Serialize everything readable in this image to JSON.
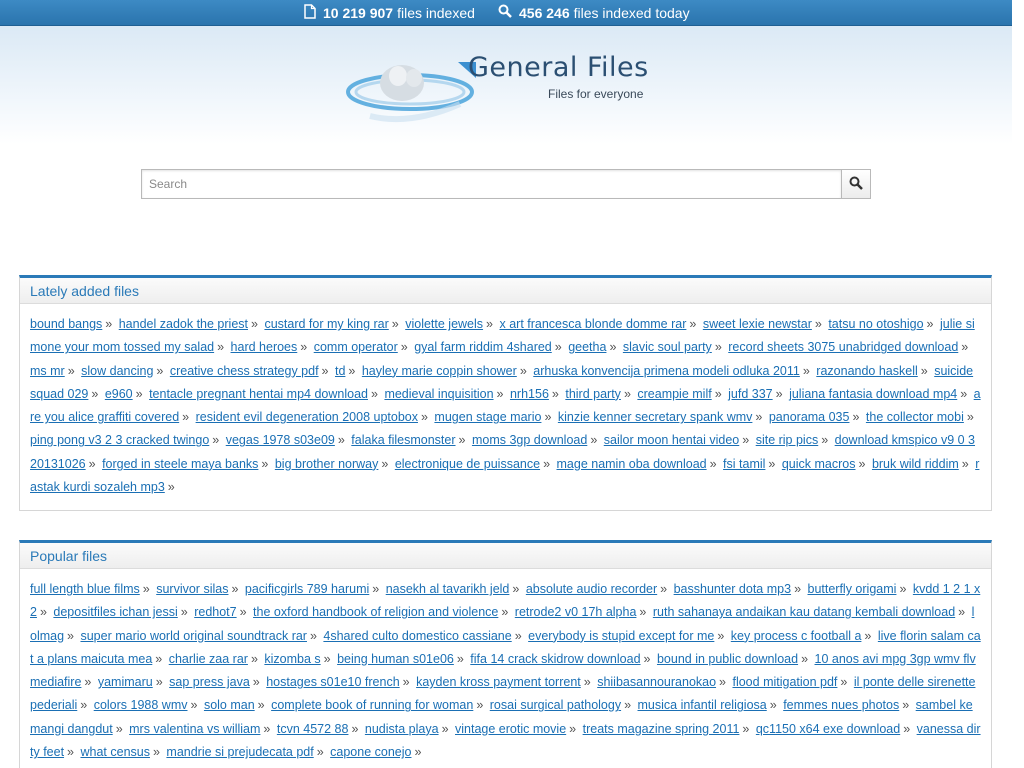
{
  "topbar": {
    "files_indexed_count": "10 219 907",
    "files_indexed_label": "files indexed",
    "files_today_count": "456 246",
    "files_today_label": "files indexed today",
    "icons": [
      "document-icon",
      "search-icon"
    ]
  },
  "logo": {
    "title": "General Files",
    "subtitle": "Files for everyone"
  },
  "search": {
    "placeholder": "Search",
    "value": ""
  },
  "lately_added": {
    "heading": "Lately added files",
    "items": [
      "bound bangs",
      "handel zadok the priest",
      "custard for my king rar",
      "violette jewels",
      "x art francesca blonde domme rar",
      "sweet lexie newstar",
      "tatsu no otoshigo",
      "julie simone your mom tossed my salad",
      "hard heroes",
      "comm operator",
      "gyal farm riddim 4shared",
      "geetha",
      "slavic soul party",
      "record sheets 3075 unabridged download",
      "ms mr",
      "slow dancing",
      "creative chess strategy pdf",
      "td",
      "hayley marie coppin shower",
      "arhuska konvencija primena modeli odluka 2011",
      "razonando haskell",
      "suicide squad 029",
      "e960",
      "tentacle pregnant hentai mp4 download",
      "medieval inquisition",
      "nrh156",
      "third party",
      "creampie milf",
      "jufd 337",
      "juliana fantasia download mp4",
      "are you alice graffiti covered",
      "resident evil degeneration 2008 uptobox",
      "mugen stage mario",
      "kinzie kenner secretary spank wmv",
      "panorama 035",
      "the collector mobi",
      "ping pong v3 2 3 cracked twingo",
      "vegas 1978 s03e09",
      "falaka filesmonster",
      "moms 3gp download",
      "sailor moon hentai video",
      "site rip pics",
      "download kmspico v9 0 3 20131026",
      "forged in steele maya banks",
      "big brother norway",
      "electronique de puissance",
      "mage namin oba download",
      "fsi tamil",
      "quick macros",
      "bruk wild riddim",
      "rastak kurdi sozaleh mp3"
    ]
  },
  "popular": {
    "heading": "Popular files",
    "items": [
      "full length blue films",
      "survivor silas",
      "pacificgirls 789 harumi",
      "nasekh al tavarikh jeld",
      "absolute audio recorder",
      "basshunter dota mp3",
      "butterfly origami",
      "kvdd 1 2 1 x2",
      "depositfiles ichan jessi",
      "redhot7",
      "the oxford handbook of religion and violence",
      "retrode2 v0 17h alpha",
      "ruth sahanaya andaikan kau datang kembali download",
      "lolmag",
      "super mario world original soundtrack rar",
      "4shared culto domestico cassiane",
      "everybody is stupid except for me",
      "key process c football a",
      "live florin salam cat a plans maicuta mea",
      "charlie zaa rar",
      "kizomba s",
      "being human s01e06",
      "fifa 14 crack skidrow download",
      "bound in public download",
      "10 anos avi mpg 3gp wmv flv mediafire",
      "yamimaru",
      "sap press java",
      "hostages s01e10 french",
      "kayden kross payment torrent",
      "shiibasannouranokao",
      "flood mitigation pdf",
      "il ponte delle sirenette pederiali",
      "colors 1988 wmv",
      "solo man",
      "complete book of running for woman",
      "rosai surgical pathology",
      "musica infantil religiosa",
      "femmes nues photos",
      "sambel kemangi dangdut",
      "mrs valentina vs william",
      "tcvn 4572 88",
      "nudista playa",
      "vintage erotic movie",
      "treats magazine spring 2011",
      "qc1150 x64 exe download",
      "vanessa dirty feet",
      "what census",
      "mandrie si prejudecata pdf",
      "capone conejo"
    ]
  },
  "separator": "»"
}
